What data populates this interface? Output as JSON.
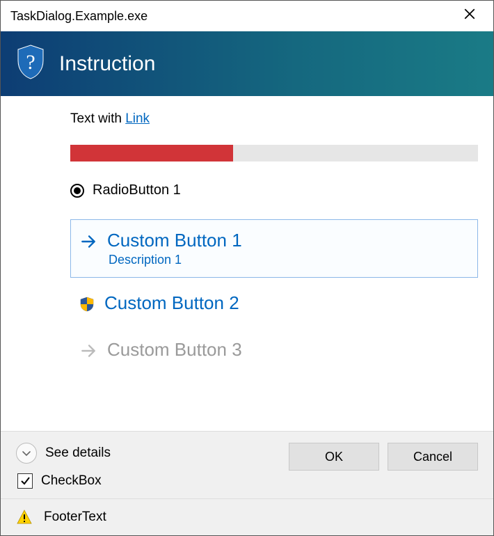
{
  "window": {
    "title": "TaskDialog.Example.exe"
  },
  "header": {
    "instruction": "Instruction"
  },
  "body": {
    "text_prefix": "Text with ",
    "link_text": "Link",
    "progress_percent": 40,
    "radio_label": "RadioButton 1",
    "command_links": [
      {
        "title": "Custom Button 1",
        "description": "Description 1",
        "selected": true,
        "icon": "arrow"
      },
      {
        "title": "Custom Button 2",
        "description": "",
        "selected": false,
        "icon": "shield"
      },
      {
        "title": "Custom Button 3",
        "description": "",
        "selected": false,
        "icon": "arrow",
        "disabled": true
      }
    ]
  },
  "footer": {
    "expand_label": "See details",
    "checkbox_label": "CheckBox",
    "checkbox_checked": true,
    "buttons": {
      "ok": "OK",
      "cancel": "Cancel"
    },
    "footer_text": "FooterText"
  }
}
